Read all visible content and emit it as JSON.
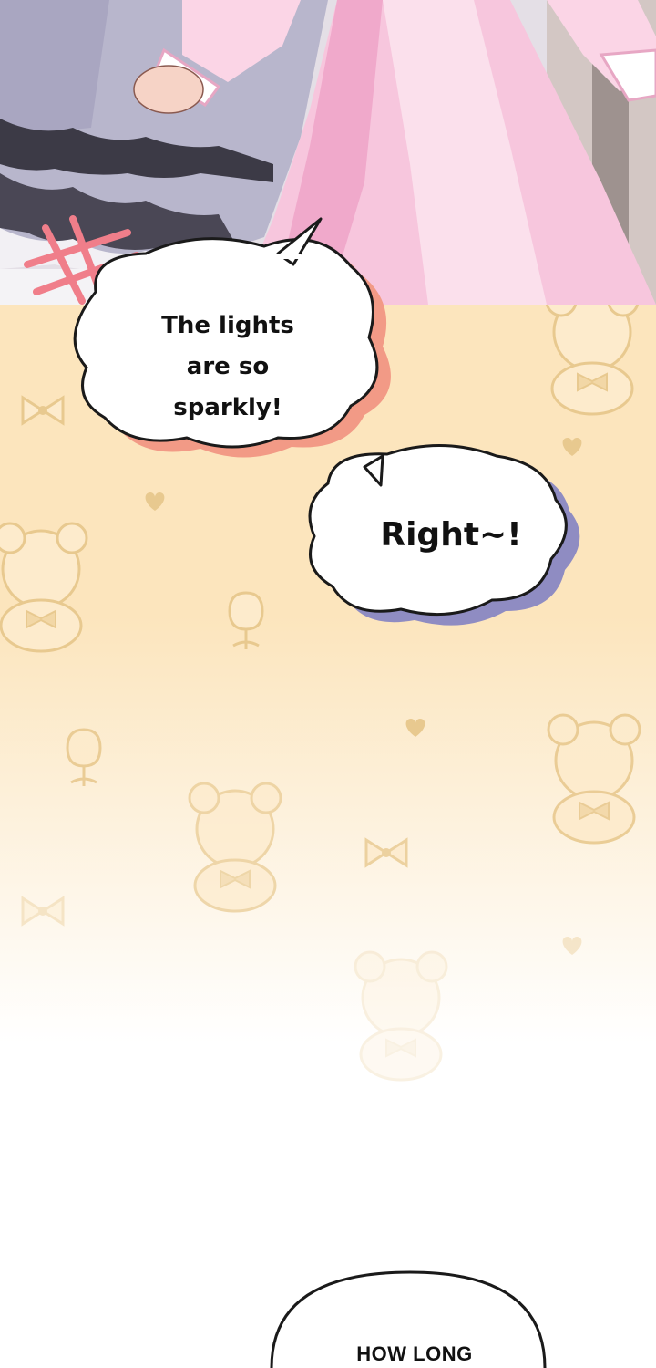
{
  "scene": {
    "colors": {
      "background": "#fce5bd",
      "pattern": "#e8c98f",
      "dress_pink": "#f7c6dd",
      "dress_lavender": "#b8b6cc",
      "bubble_shadow_left": "#f29a86",
      "bubble_shadow_right": "#8f8cc2"
    },
    "icons": [
      "bear-icon",
      "bow-icon",
      "heart-icon",
      "tulip-icon",
      "scribble-icon"
    ]
  },
  "speech": {
    "bubble1": {
      "line1": "The lights",
      "line2": "are so sparkly!"
    },
    "bubble2": {
      "text": "Right~!"
    },
    "bubble3": {
      "text": "HOW LONG"
    }
  }
}
